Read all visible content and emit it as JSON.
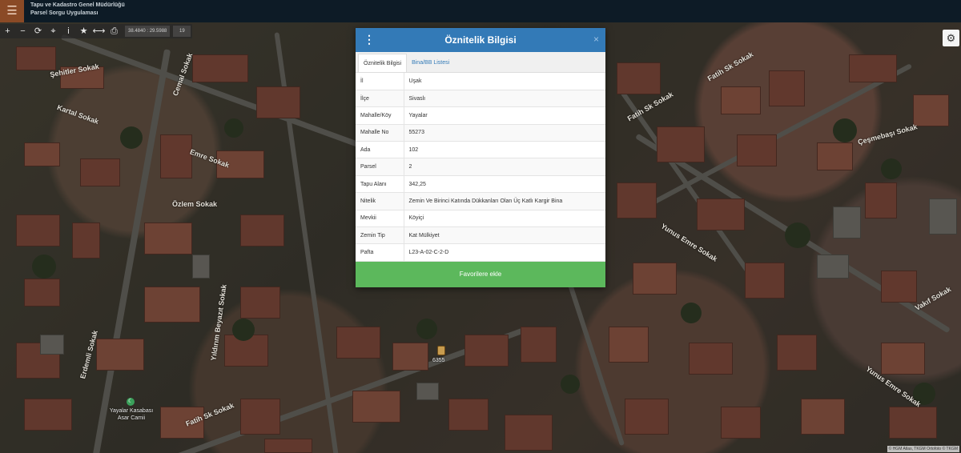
{
  "header": {
    "title_line1": "Tapu ve Kadastro Genel Müdürlüğü",
    "title_line2": "Parsel Sorgu Uygulaması",
    "menu_icon": "hamburger-icon"
  },
  "toolbar": {
    "icons": [
      "plus-icon",
      "minus-icon",
      "refresh-icon",
      "locate-icon",
      "info-icon",
      "star-icon",
      "measure-icon",
      "print-icon"
    ],
    "glyphs": [
      "+",
      "−",
      "⟳",
      "⌖",
      "i",
      "★",
      "⟷",
      "⎙"
    ],
    "coordinates": "38.4840 : 29.5988",
    "zoom": "19"
  },
  "map": {
    "streets": [
      "Şehitler Sokak",
      "Cemal Sokak",
      "Kartal Sokak",
      "Emre Sokak",
      "Özlem Sokak",
      "Yıldırım Beyazıt Sokak",
      "Erdemli Sokak",
      "Fatih Sk Sokak",
      "Fatih Sk Sokak",
      "Çeşmebaşı Sokak",
      "Yunus Emre Sokak",
      "Yunus Emre Sokak",
      "Vakıf Sokak",
      "Fatih Sk Sokak"
    ],
    "parcel_marker_label": "6355",
    "poi_label_line1": "Yayalar Kasabası",
    "poi_label_line2": "Asar Camii",
    "attribution": "© HGM Atlas, TKGM Ortofoto © TKGM"
  },
  "modal": {
    "title": "Öznitelik Bilgisi",
    "close": "×",
    "tabs": [
      "Öznitelik Bilgisi",
      "Bina/BB Listesi"
    ],
    "rows": [
      {
        "key": "İl",
        "value": "Uşak"
      },
      {
        "key": "İlçe",
        "value": "Sivaslı"
      },
      {
        "key": "Mahalle/Köy",
        "value": "Yayalar"
      },
      {
        "key": "Mahalle No",
        "value": "55273"
      },
      {
        "key": "Ada",
        "value": "102"
      },
      {
        "key": "Parsel",
        "value": "2"
      },
      {
        "key": "Tapu Alanı",
        "value": "342,25"
      },
      {
        "key": "Nitelik",
        "value": "Zemin Ve Birinci Katında Dükkanları Olan Üç Katlı Kargir Bina"
      },
      {
        "key": "Mevkii",
        "value": "Köyiçi"
      },
      {
        "key": "Zemin Tip",
        "value": "Kat Mülkiyet"
      },
      {
        "key": "Pafta",
        "value": "L23-A-02-C-2-D"
      }
    ],
    "favorite_button": "Favorilere ekle"
  },
  "colors": {
    "header_bg": "#0d1b26",
    "modal_header": "#337ab7",
    "favorite_button": "#5cb85c",
    "menu_button": "#8a4a26"
  }
}
